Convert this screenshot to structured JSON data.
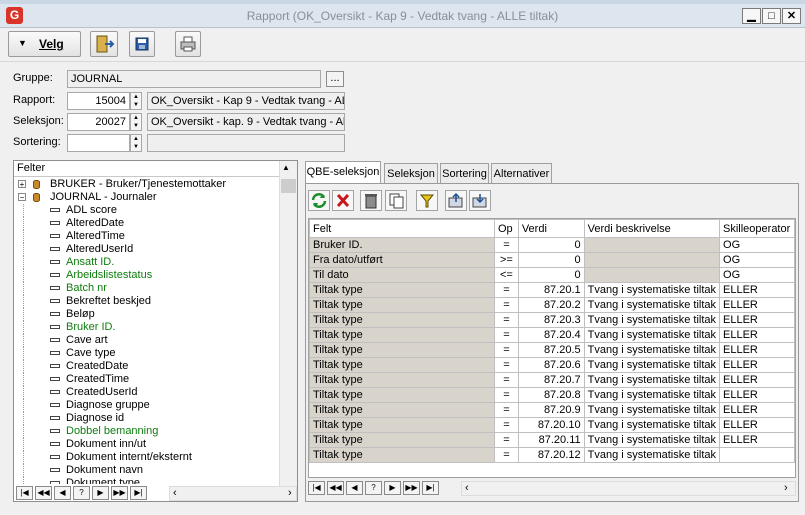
{
  "window": {
    "title": "Rapport (OK_Oversikt - Kap 9 - Vedtak tvang - ALLE tiltak)",
    "app_icon_letter": "G",
    "minimize": "▁",
    "maximize": "□",
    "close": "✕"
  },
  "toolbar": {
    "velg_label": "Velg"
  },
  "form": {
    "gruppe_label": "Gruppe:",
    "gruppe_value": "JOURNAL",
    "browse_label": "...",
    "rapport_label": "Rapport:",
    "rapport_id": "15004",
    "rapport_name": "OK_Oversikt - Kap 9 - Vedtak tvang - AL",
    "seleksjon_label": "Seleksjon:",
    "seleksjon_id": "20027",
    "seleksjon_name": "OK_Oversikt - kap. 9 - Vedtak tvang - Al",
    "sortering_label": "Sortering:",
    "sortering_id": "",
    "sortering_name": ""
  },
  "felter": {
    "header": "Felter",
    "tree": [
      {
        "label": "BRUKER - Bruker/Tjenestemottaker",
        "level": 0,
        "expander": "+",
        "color": "black"
      },
      {
        "label": "JOURNAL - Journaler",
        "level": 0,
        "expander": "−",
        "color": "black"
      },
      {
        "label": "ADL score",
        "level": 1,
        "color": "black"
      },
      {
        "label": "AlteredDate",
        "level": 1,
        "color": "black"
      },
      {
        "label": "AlteredTime",
        "level": 1,
        "color": "black"
      },
      {
        "label": "AlteredUserId",
        "level": 1,
        "color": "black"
      },
      {
        "label": "Ansatt ID.",
        "level": 1,
        "color": "green"
      },
      {
        "label": "Arbeidslistestatus",
        "level": 1,
        "color": "green"
      },
      {
        "label": "Batch nr",
        "level": 1,
        "color": "green"
      },
      {
        "label": "Bekreftet beskjed",
        "level": 1,
        "color": "black"
      },
      {
        "label": "Beløp",
        "level": 1,
        "color": "black"
      },
      {
        "label": "Bruker ID.",
        "level": 1,
        "color": "green"
      },
      {
        "label": "Cave art",
        "level": 1,
        "color": "black"
      },
      {
        "label": "Cave type",
        "level": 1,
        "color": "black"
      },
      {
        "label": "CreatedDate",
        "level": 1,
        "color": "black"
      },
      {
        "label": "CreatedTime",
        "level": 1,
        "color": "black"
      },
      {
        "label": "CreatedUserId",
        "level": 1,
        "color": "black"
      },
      {
        "label": "Diagnose gruppe",
        "level": 1,
        "color": "black"
      },
      {
        "label": "Diagnose id",
        "level": 1,
        "color": "black"
      },
      {
        "label": "Dobbel bemanning",
        "level": 1,
        "color": "green"
      },
      {
        "label": "Dokument inn/ut",
        "level": 1,
        "color": "black"
      },
      {
        "label": "Dokument internt/eksternt",
        "level": 1,
        "color": "black"
      },
      {
        "label": "Dokument navn",
        "level": 1,
        "color": "black"
      },
      {
        "label": "Dokument type",
        "level": 1,
        "color": "black"
      }
    ]
  },
  "tabs": [
    "QBE-seleksjon",
    "Seleksjon",
    "Sortering",
    "Alternativer"
  ],
  "grid": {
    "columns": [
      "Felt",
      "Op",
      "Verdi",
      "Verdi beskrivelse",
      "Skilleoperator"
    ],
    "rows": [
      {
        "felt": "Bruker ID.",
        "op": "=",
        "verdi": "0",
        "beskrivelse": "",
        "skille": "OG"
      },
      {
        "felt": "Fra dato/utført",
        "op": ">=",
        "verdi": "0",
        "beskrivelse": "",
        "skille": "OG"
      },
      {
        "felt": "Til dato",
        "op": "<=",
        "verdi": "0",
        "beskrivelse": "",
        "skille": "OG"
      },
      {
        "felt": "Tiltak type",
        "op": "=",
        "verdi": "87.20.1",
        "beskrivelse": "Tvang i systematiske tiltak",
        "skille": "ELLER"
      },
      {
        "felt": "Tiltak type",
        "op": "=",
        "verdi": "87.20.2",
        "beskrivelse": "Tvang i systematiske tiltak",
        "skille": "ELLER"
      },
      {
        "felt": "Tiltak type",
        "op": "=",
        "verdi": "87.20.3",
        "beskrivelse": "Tvang i systematiske tiltak",
        "skille": "ELLER"
      },
      {
        "felt": "Tiltak type",
        "op": "=",
        "verdi": "87.20.4",
        "beskrivelse": "Tvang i systematiske tiltak",
        "skille": "ELLER"
      },
      {
        "felt": "Tiltak type",
        "op": "=",
        "verdi": "87.20.5",
        "beskrivelse": "Tvang i systematiske tiltak",
        "skille": "ELLER"
      },
      {
        "felt": "Tiltak type",
        "op": "=",
        "verdi": "87.20.6",
        "beskrivelse": "Tvang i systematiske tiltak",
        "skille": "ELLER"
      },
      {
        "felt": "Tiltak type",
        "op": "=",
        "verdi": "87.20.7",
        "beskrivelse": "Tvang i systematiske tiltak",
        "skille": "ELLER"
      },
      {
        "felt": "Tiltak type",
        "op": "=",
        "verdi": "87.20.8",
        "beskrivelse": "Tvang i systematiske tiltak",
        "skille": "ELLER"
      },
      {
        "felt": "Tiltak type",
        "op": "=",
        "verdi": "87.20.9",
        "beskrivelse": "Tvang i systematiske tiltak",
        "skille": "ELLER"
      },
      {
        "felt": "Tiltak type",
        "op": "=",
        "verdi": "87.20.10",
        "beskrivelse": "Tvang i systematiske tiltak",
        "skille": "ELLER"
      },
      {
        "felt": "Tiltak type",
        "op": "=",
        "verdi": "87.20.11",
        "beskrivelse": "Tvang i systematiske tiltak",
        "skille": "ELLER"
      },
      {
        "felt": "Tiltak type",
        "op": "=",
        "verdi": "87.20.12",
        "beskrivelse": "Tvang i systematiske tiltak",
        "skille": ""
      }
    ]
  },
  "nav": [
    "|◀",
    "◀◀",
    "◀",
    "?",
    "▶",
    "▶▶",
    "▶|"
  ]
}
